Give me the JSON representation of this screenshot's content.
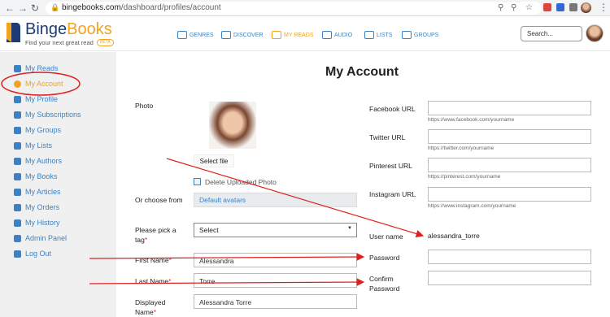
{
  "browser": {
    "url_host": "bingebooks.com",
    "url_path": "/dashboard/profiles/account"
  },
  "header": {
    "logo": {
      "binge": "Binge",
      "books": "Books",
      "tagline": "Find your next great read",
      "beta": "BETA"
    },
    "nav": [
      {
        "label": "GENRES",
        "icon": "grid-icon"
      },
      {
        "label": "DISCOVER",
        "icon": "compass-icon"
      },
      {
        "label": "MY READS",
        "icon": "book-open-icon"
      },
      {
        "label": "AUDIO",
        "icon": "headphones-icon"
      },
      {
        "label": "LISTS",
        "icon": "list-icon"
      },
      {
        "label": "GROUPS",
        "icon": "people-icon"
      }
    ],
    "search_placeholder": "Search..."
  },
  "sidebar": {
    "items": [
      {
        "label": "My Reads",
        "icon": "dashboard-icon"
      },
      {
        "label": "My Account",
        "icon": "gear-icon",
        "active": true
      },
      {
        "label": "My Profile",
        "icon": "user-icon"
      },
      {
        "label": "My Subscriptions",
        "icon": "envelope-icon"
      },
      {
        "label": "My Groups",
        "icon": "users-icon"
      },
      {
        "label": "My Lists",
        "icon": "list-icon"
      },
      {
        "label": "My Authors",
        "icon": "pen-icon"
      },
      {
        "label": "My Books",
        "icon": "book-icon"
      },
      {
        "label": "My Articles",
        "icon": "article-icon"
      },
      {
        "label": "My Orders",
        "icon": "cart-icon"
      },
      {
        "label": "My History",
        "icon": "user-clock-icon"
      },
      {
        "label": "Admin Panel",
        "icon": "cogs-icon"
      },
      {
        "label": "Log Out",
        "icon": "logout-icon"
      }
    ]
  },
  "main": {
    "title": "My Account",
    "photo_label": "Photo",
    "select_file": "Select file",
    "delete_photo": "Delete Uploaded Photo",
    "or_choose_from": "Or choose from",
    "default_avatars": "Default avatars",
    "tag_label": "Please pick a tag",
    "tag_value": "Select",
    "first_name_label": "First Name",
    "first_name_value": "Alessandra",
    "last_name_label": "Last Name",
    "last_name_value": "Torre",
    "displayed_name_label": "Displayed Name",
    "displayed_name_value": "Alessandra Torre",
    "facebook_label": "Facebook URL",
    "facebook_hint": "https://www.facebook.com/yourname",
    "twitter_label": "Twitter URL",
    "twitter_hint": "https://twitter.com/yourname",
    "pinterest_label": "Pinterest URL",
    "pinterest_hint": "https://pinterest.com/yourname",
    "instagram_label": "Instagram URL",
    "instagram_hint": "https://www.instagram.com/yourname",
    "username_label": "User name",
    "username_value": "alessandra_torre",
    "password_label": "Password",
    "confirm_password_label": "Confirm Password"
  },
  "colors": {
    "brand_blue": "#1f3b73",
    "link_blue": "#3b82c4",
    "accent_orange": "#f0a31c",
    "annotation_red": "#e02020"
  }
}
